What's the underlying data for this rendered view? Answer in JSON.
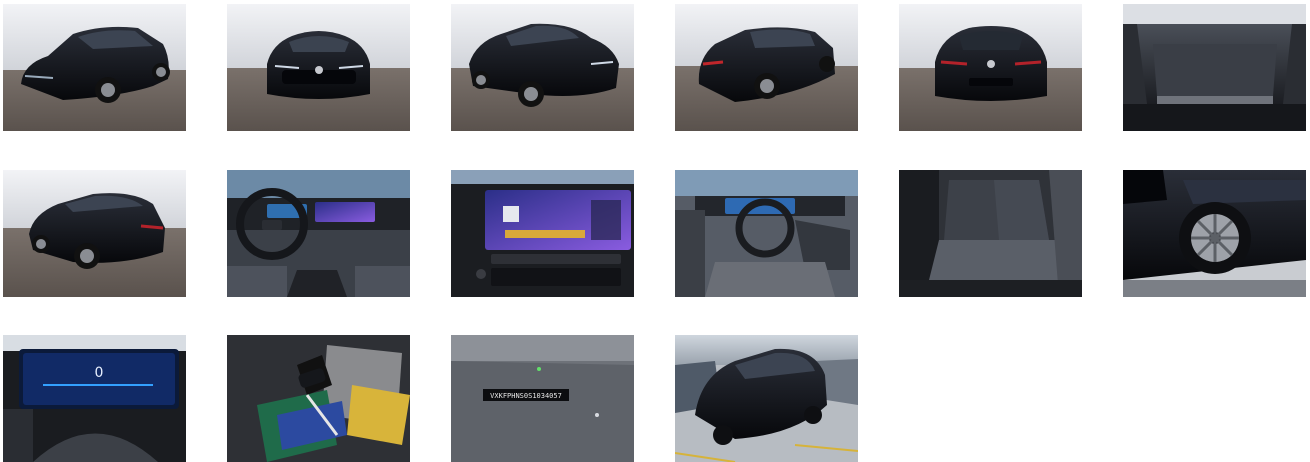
{
  "gallery": {
    "photos": [
      {
        "subject": "exterior front-left three-quarter, studio"
      },
      {
        "subject": "exterior front view, studio"
      },
      {
        "subject": "exterior front-right three-quarter, studio"
      },
      {
        "subject": "exterior rear-right three-quarter, studio"
      },
      {
        "subject": "exterior rear view, studio"
      },
      {
        "subject": "open trunk / cargo area"
      },
      {
        "subject": "exterior rear-left three-quarter, studio"
      },
      {
        "subject": "dashboard and steering wheel"
      },
      {
        "subject": "infotainment touchscreen"
      },
      {
        "subject": "driver seat and cockpit"
      },
      {
        "subject": "rear seats"
      },
      {
        "subject": "wheel close-up"
      },
      {
        "subject": "digital instrument cluster",
        "cluster_reading": "0"
      },
      {
        "subject": "keys and documents"
      },
      {
        "subject": "VIN plate",
        "vin_text": "VXKFPHNS0S1034057"
      },
      {
        "subject": "exterior front, parking lot"
      }
    ]
  },
  "colors": {
    "car": "#0b0d12",
    "studio_wall": "#e4e6ea",
    "studio_floor": "#6b635e",
    "interior": "#2a2c31",
    "screen_accent": "#5a3fc8"
  }
}
